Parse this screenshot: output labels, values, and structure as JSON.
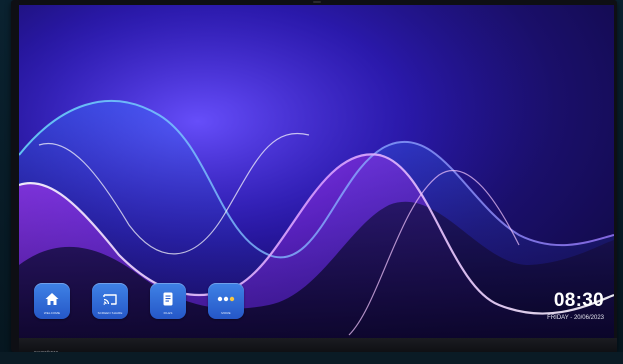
{
  "dock": {
    "apps": [
      {
        "label": "WELCOME",
        "icon": "home-icon"
      },
      {
        "label": "SCREEN SHARE",
        "icon": "cast-icon"
      },
      {
        "label": "FILES",
        "icon": "document-icon"
      },
      {
        "label": "MORE",
        "icon": "more-dots-icon"
      }
    ]
  },
  "clock": {
    "time": "08:30",
    "day": "FRIDAY",
    "separator": " - ",
    "date": "20/06/2023"
  },
  "device": {
    "brand": "promethean"
  },
  "colors": {
    "app_button": "#2f6ad8",
    "wallpaper_base": "#2a1aa8",
    "wave_highlight": "#c46bff"
  }
}
